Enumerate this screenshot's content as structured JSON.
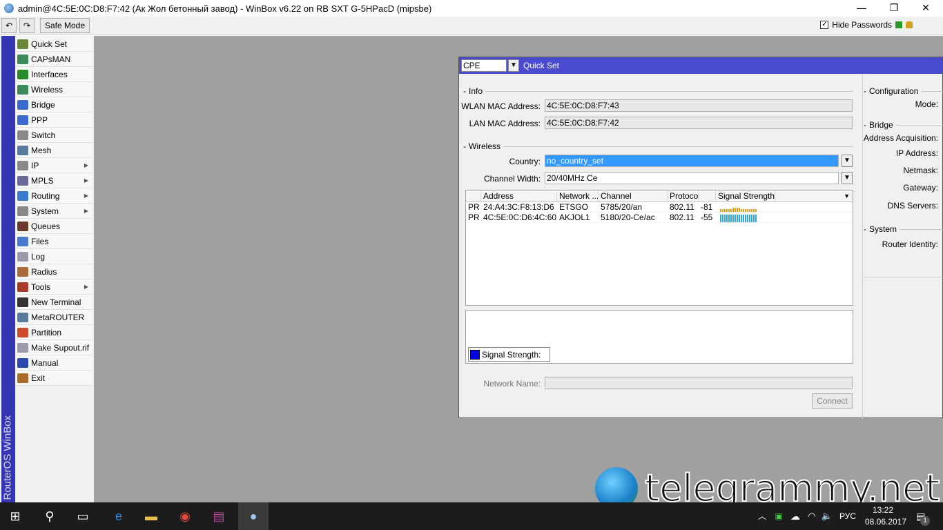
{
  "window": {
    "title": "admin@4C:5E:0C:D8:F7:42 (Ак Жол бетонный завод) - WinBox v6.22 on RB SXT G-5HPacD (mipsbe)",
    "minimize": "—",
    "maximize": "❐",
    "close": "✕"
  },
  "toolbar": {
    "undo": "↶",
    "redo": "↷",
    "safe_mode": "Safe Mode",
    "hide_passwords": "Hide Passwords",
    "hide_checked": "✓"
  },
  "sidebar": {
    "brand": "RouterOS WinBox",
    "items": [
      {
        "label": "Quick Set",
        "color": "#6a8a3a"
      },
      {
        "label": "CAPsMAN",
        "color": "#3a8a5a"
      },
      {
        "label": "Interfaces",
        "color": "#2a8a2a"
      },
      {
        "label": "Wireless",
        "color": "#3a8a5a"
      },
      {
        "label": "Bridge",
        "color": "#3a6ad0"
      },
      {
        "label": "PPP",
        "color": "#3a6ad0"
      },
      {
        "label": "Switch",
        "color": "#888888"
      },
      {
        "label": "Mesh",
        "color": "#5a7aa0"
      },
      {
        "label": "IP",
        "color": "#888888",
        "sub": true
      },
      {
        "label": "MPLS",
        "color": "#6a6a9a",
        "sub": true
      },
      {
        "label": "Routing",
        "color": "#3a7ad0",
        "sub": true
      },
      {
        "label": "System",
        "color": "#888888",
        "sub": true
      },
      {
        "label": "Queues",
        "color": "#6a3a2a"
      },
      {
        "label": "Files",
        "color": "#4a7ad0"
      },
      {
        "label": "Log",
        "color": "#9a9aaa"
      },
      {
        "label": "Radius",
        "color": "#aa6a3a"
      },
      {
        "label": "Tools",
        "color": "#aa3a2a",
        "sub": true
      },
      {
        "label": "New Terminal",
        "color": "#333333"
      },
      {
        "label": "MetaROUTER",
        "color": "#5a7aa0"
      },
      {
        "label": "Partition",
        "color": "#d04a2a"
      },
      {
        "label": "Make Supout.rif",
        "color": "#9a9aaa"
      },
      {
        "label": "Manual",
        "color": "#2a4ab0"
      },
      {
        "label": "Exit",
        "color": "#aa6a2a"
      }
    ]
  },
  "quickset": {
    "mode_select": "CPE",
    "title": "Quick Set",
    "info": {
      "heading": "Info",
      "wlan_mac_label": "WLAN MAC Address:",
      "wlan_mac": "4C:5E:0C:D8:F7:43",
      "lan_mac_label": "LAN MAC Address:",
      "lan_mac": "4C:5E:0C:D8:F7:42"
    },
    "wireless": {
      "heading": "Wireless",
      "country_label": "Country:",
      "country": "no_country_set",
      "width_label": "Channel Width:",
      "width": "20/40MHz Ce"
    },
    "table": {
      "headers": [
        "",
        "Address",
        "Network ...",
        "Channel",
        "Protocol",
        "",
        "Signal Strength"
      ],
      "rows": [
        {
          "flags": "PR",
          "address": "24:A4:3C:F8:13:D6",
          "network": "ETSGO",
          "channel": "5785/20/an",
          "protocol": "802.11",
          "signal": "-81",
          "strength": 0.35,
          "color": "#e0a020"
        },
        {
          "flags": "PR",
          "address": "4C:5E:0C:D6:4C:60",
          "network": "AKJOL1",
          "channel": "5180/20-Ce/ac",
          "protocol": "802.11",
          "signal": "-55",
          "strength": 1.0,
          "color": "#30a8d8"
        }
      ]
    },
    "chart_legend": "Signal Strength:",
    "network_name_label": "Network Name:",
    "connect": "Connect",
    "config": {
      "heading": "Configuration",
      "mode_label": "Mode:"
    },
    "bridge": {
      "heading": "Bridge",
      "acq_label": "Address Acquisition:",
      "ip_label": "IP Address:",
      "netmask_label": "Netmask:",
      "gateway_label": "Gateway:",
      "dns_label": "DNS Servers:"
    },
    "system": {
      "heading": "System",
      "identity_label": "Router Identity:"
    }
  },
  "taskbar": {
    "lang": "РУС",
    "time": "13:22",
    "date": "08.06.2017",
    "notifications": "1"
  },
  "watermark": "telegrammy.net"
}
